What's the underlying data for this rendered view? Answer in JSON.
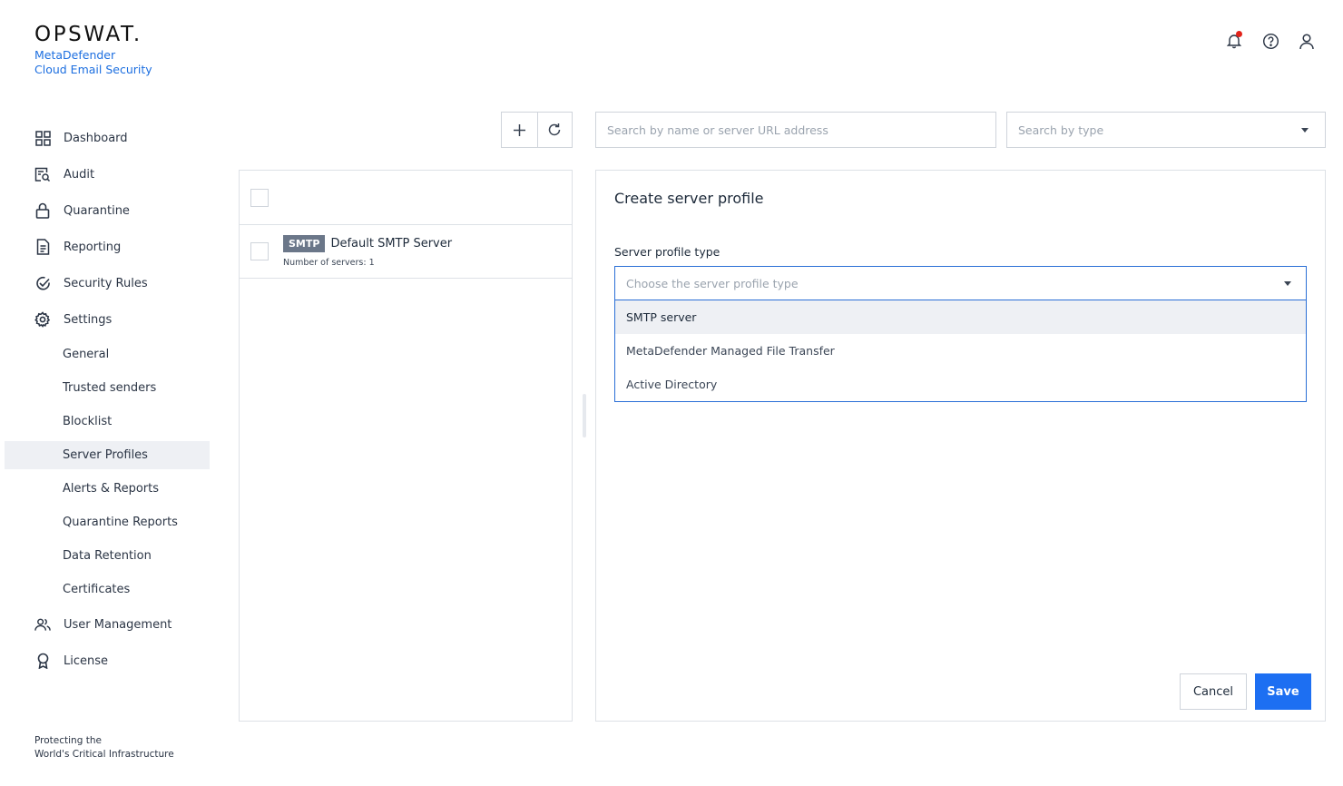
{
  "brand": {
    "logo_text": "OPSWAT.",
    "product_line1": "MetaDefender",
    "product_line2": "Cloud Email Security",
    "accent_color": "#1d6ff2"
  },
  "header": {
    "icons": [
      "bell-icon",
      "help-icon",
      "user-icon"
    ],
    "notification_dot": true
  },
  "sidebar": {
    "items": [
      {
        "label": "Dashboard",
        "icon": "dashboard-icon"
      },
      {
        "label": "Audit",
        "icon": "audit-icon"
      },
      {
        "label": "Quarantine",
        "icon": "lock-icon"
      },
      {
        "label": "Reporting",
        "icon": "document-icon"
      },
      {
        "label": "Security Rules",
        "icon": "shield-check-icon"
      },
      {
        "label": "Settings",
        "icon": "gear-icon"
      }
    ],
    "settings_sub": [
      "General",
      "Trusted senders",
      "Blocklist",
      "Server Profiles",
      "Alerts & Reports",
      "Quarantine Reports",
      "Data Retention",
      "Certificates"
    ],
    "active_sub": "Server Profiles",
    "bottom_items": [
      {
        "label": "User Management",
        "icon": "users-icon"
      },
      {
        "label": "License",
        "icon": "award-icon"
      }
    ],
    "footer_line1": "Protecting the",
    "footer_line2": "World's Critical Infrastructure"
  },
  "toolbar": {
    "add_icon": "plus-icon",
    "refresh_icon": "refresh-icon",
    "search_placeholder": "Search by name or server URL address",
    "type_placeholder": "Search by type"
  },
  "server_list": {
    "rows": [
      {
        "badge": "SMTP",
        "name": "Default SMTP Server",
        "subtitle": "Number of servers: 1"
      }
    ]
  },
  "form": {
    "title": "Create server profile",
    "field_label": "Server profile type",
    "dropdown_placeholder": "Choose the server profile type",
    "options": [
      "SMTP server",
      "MetaDefender Managed File Transfer",
      "Active Directory"
    ],
    "highlighted_option": "SMTP server",
    "cancel_label": "Cancel",
    "save_label": "Save"
  }
}
